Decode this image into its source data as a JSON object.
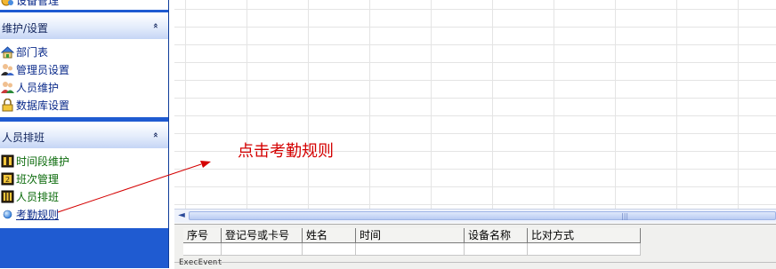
{
  "nav": {
    "top_partial_label": "设备管理",
    "sections": [
      {
        "title": "维护/设置",
        "items": [
          {
            "label": "部门表",
            "icon": "house-icon"
          },
          {
            "label": "管理员设置",
            "icon": "admin-users-icon"
          },
          {
            "label": "人员维护",
            "icon": "people-icon"
          },
          {
            "label": "数据库设置",
            "icon": "lock-icon"
          }
        ]
      },
      {
        "title": "人员排班",
        "items": [
          {
            "label": "时间段维护",
            "icon": "time-segment-icon"
          },
          {
            "label": "班次管理",
            "icon": "shift-icon"
          },
          {
            "label": "人员排班",
            "icon": "scheduling-icon"
          },
          {
            "label": "考勤规则",
            "icon": "blue-dot-icon"
          }
        ]
      }
    ],
    "collapse_glyph": "«"
  },
  "annotation": {
    "text": "点击考勤规则",
    "color": "#d40000"
  },
  "scrollbar": {
    "left_arrow": "◄",
    "grip": "|||"
  },
  "table": {
    "columns": [
      "序号",
      "登记号或卡号",
      "姓名",
      "时间",
      "设备名称",
      "比对方式"
    ]
  },
  "status_text": "ExecEvent"
}
